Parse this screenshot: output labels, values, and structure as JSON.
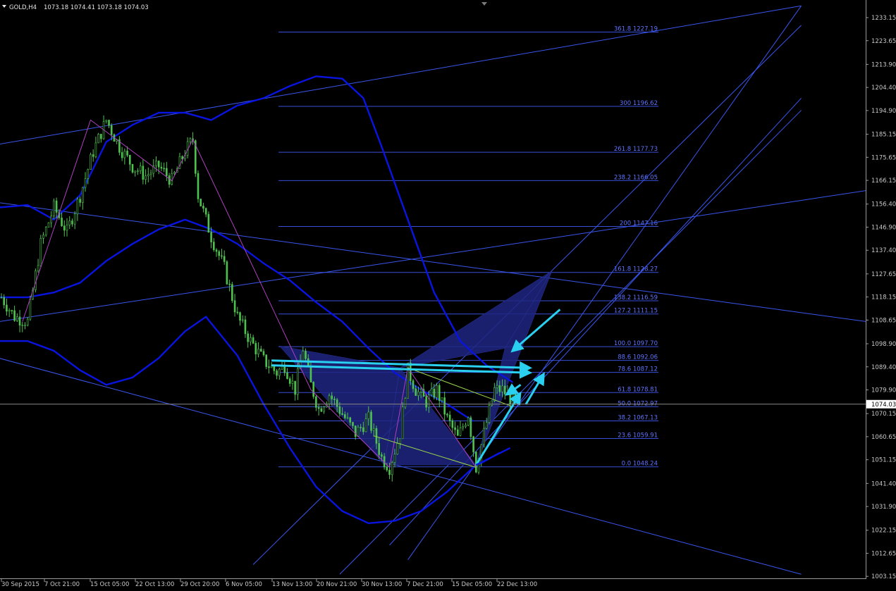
{
  "header": {
    "symbol": "GOLD,H4",
    "ohlc": "1073.18 1074.41 1073.18 1074.03"
  },
  "chart_data": {
    "type": "candlestick",
    "symbol": "GOLD",
    "timeframe": "H4",
    "ylim": [
      1000.0,
      1238.0
    ],
    "y_ticks": [
      1233.15,
      1223.65,
      1213.9,
      1204.4,
      1194.9,
      1185.15,
      1175.65,
      1166.15,
      1156.4,
      1146.9,
      1137.4,
      1127.65,
      1118.15,
      1108.65,
      1098.9,
      1089.4,
      1079.9,
      1070.15,
      1060.65,
      1051.15,
      1041.4,
      1031.9,
      1022.15,
      1012.65,
      1003.15
    ],
    "y_tick_labels": [
      "1233.15",
      "1223.65",
      "1213.90",
      "1204.40",
      "1194.90",
      "1185.15",
      "1175.65",
      "1166.15",
      "1156.40",
      "1146.90",
      "1137.40",
      "1127.65",
      "1118.15",
      "1108.65",
      "1098.90",
      "1089.40",
      "1079.90",
      "1070.15",
      "1060.65",
      "1051.15",
      "1041.40",
      "1031.90",
      "1022.15",
      "1012.65",
      "1003.15"
    ],
    "x_tick_labels": [
      "30 Sep 2015",
      "7 Oct 21:00",
      "15 Oct 05:00",
      "22 Oct 13:00",
      "29 Oct 20:00",
      "6 Nov 05:00",
      "13 Nov 13:00",
      "20 Nov 21:00",
      "30 Nov 13:00",
      "7 Dec 21:00",
      "15 Dec 05:00",
      "22 Dec 13:00"
    ],
    "current_price": 1074.03,
    "current_price_label": "1074.03",
    "price_path": [
      [
        0,
        1118
      ],
      [
        5,
        1110
      ],
      [
        10,
        1108
      ],
      [
        15,
        1140
      ],
      [
        20,
        1155
      ],
      [
        25,
        1145
      ],
      [
        30,
        1160
      ],
      [
        35,
        1178
      ],
      [
        40,
        1191
      ],
      [
        45,
        1180
      ],
      [
        50,
        1172
      ],
      [
        55,
        1168
      ],
      [
        60,
        1172
      ],
      [
        65,
        1166
      ],
      [
        70,
        1178
      ],
      [
        73,
        1183
      ],
      [
        75,
        1160
      ],
      [
        80,
        1143
      ],
      [
        85,
        1130
      ],
      [
        90,
        1110
      ],
      [
        95,
        1100
      ],
      [
        100,
        1092
      ],
      [
        105,
        1087
      ],
      [
        108,
        1090
      ],
      [
        112,
        1080
      ],
      [
        115,
        1097
      ],
      [
        118,
        1082
      ],
      [
        121,
        1072
      ],
      [
        125,
        1078
      ],
      [
        130,
        1070
      ],
      [
        135,
        1062
      ],
      [
        140,
        1068
      ],
      [
        145,
        1052
      ],
      [
        148,
        1048
      ],
      [
        152,
        1062
      ],
      [
        155,
        1088
      ],
      [
        158,
        1080
      ],
      [
        162,
        1075
      ],
      [
        166,
        1080
      ],
      [
        170,
        1068
      ],
      [
        174,
        1060
      ],
      [
        178,
        1070
      ],
      [
        181,
        1048
      ],
      [
        184,
        1062
      ],
      [
        188,
        1080
      ],
      [
        191,
        1080
      ],
      [
        196,
        1074
      ]
    ],
    "fib_levels": [
      {
        "ratio": "361.8",
        "value": "1227.19"
      },
      {
        "ratio": "300",
        "value": "1196.62"
      },
      {
        "ratio": "261.8",
        "value": "1177.73"
      },
      {
        "ratio": "238.2",
        "value": "1166.05"
      },
      {
        "ratio": "200",
        "value": "1147.16"
      },
      {
        "ratio": "161.8",
        "value": "1128.27"
      },
      {
        "ratio": "138.2",
        "value": "1116.59"
      },
      {
        "ratio": "127.2",
        "value": "1111.15"
      },
      {
        "ratio": "100.0",
        "value": "1097.70"
      },
      {
        "ratio": "88.6",
        "value": "1092.06"
      },
      {
        "ratio": "78.6",
        "value": "1087.12"
      },
      {
        "ratio": "61.8",
        "value": "1078.81"
      },
      {
        "ratio": "50.0",
        "value": "1072.97"
      },
      {
        "ratio": "38.2",
        "value": "1067.13"
      },
      {
        "ratio": "23.6",
        "value": "1059.91"
      },
      {
        "ratio": "0.0",
        "value": "1048.24"
      }
    ],
    "colors": {
      "background": "#000000",
      "candle": "#4fc24f",
      "band": "#0a14e0",
      "fib": "#3a4fd8",
      "trendline": "#3a56ee",
      "pattern_fill": "#1e2680",
      "arrow": "#2ad0f0",
      "zigzag": "#b040c0",
      "axis_text": "#c8c8c8"
    }
  }
}
